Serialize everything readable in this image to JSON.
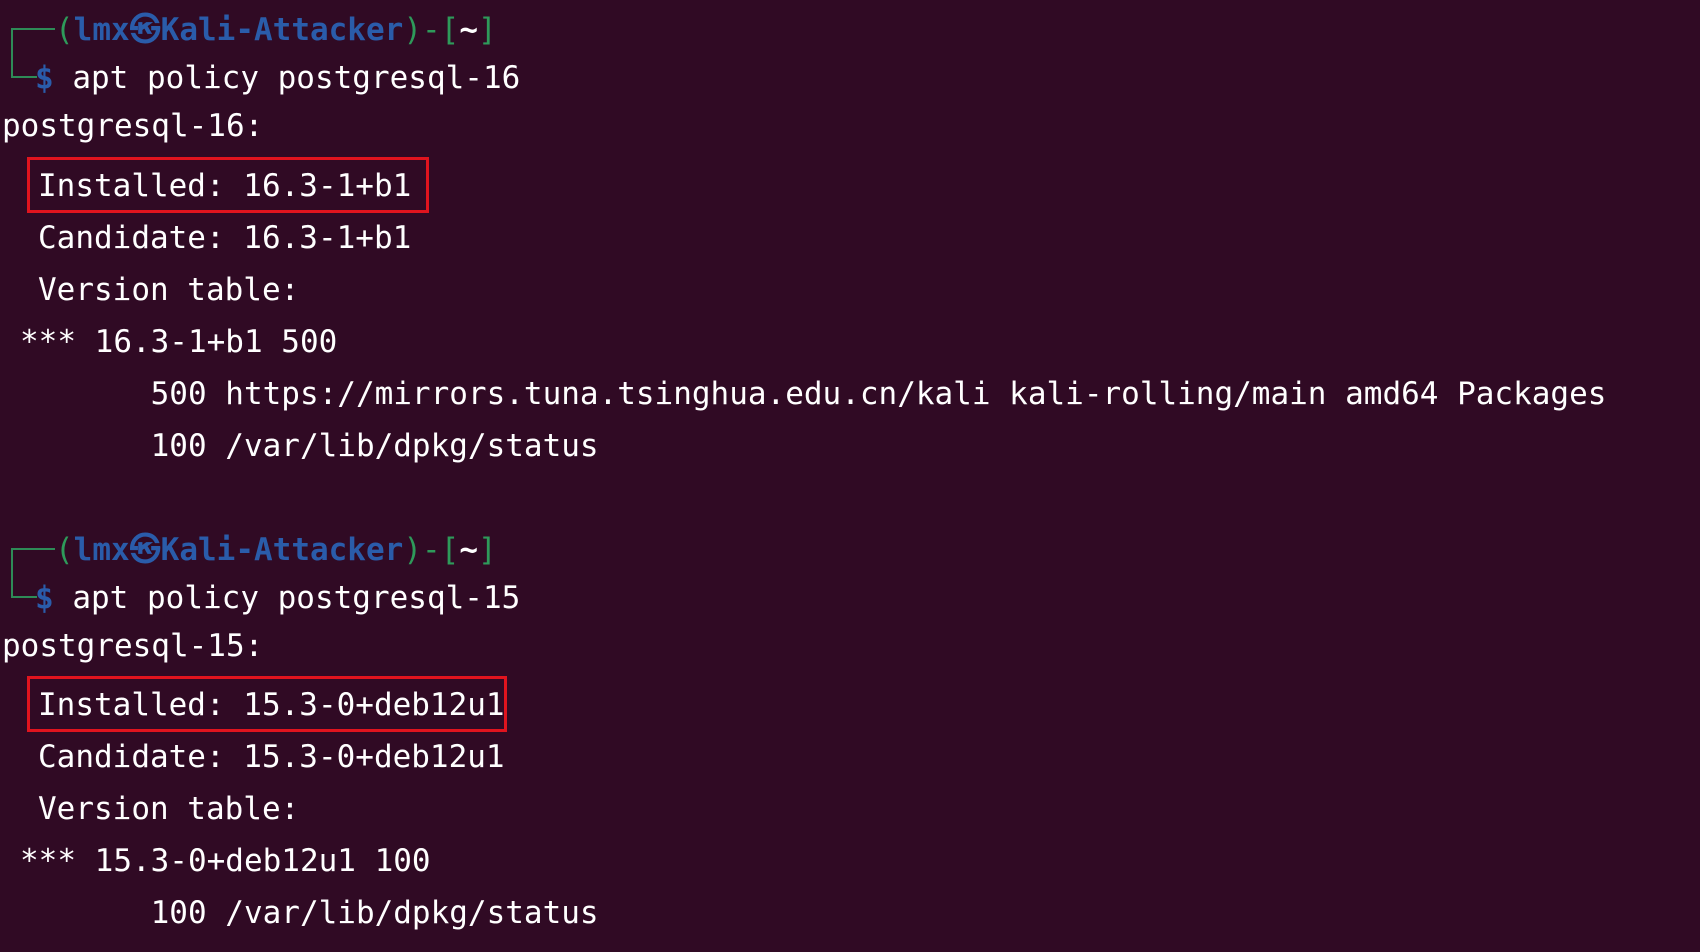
{
  "colors": {
    "background": "#300a24",
    "prompt_bracket": "#2e9a5a",
    "prompt_user": "#2a5caa",
    "text": "#ffffff",
    "highlight": "#e0141e"
  },
  "blocks": [
    {
      "prompt": {
        "open": "(",
        "user": "lmx",
        "sep": "㉿",
        "host": "Kali-Attacker",
        "close": ")-[",
        "dir": "~",
        "end": "]",
        "symbol": "$"
      },
      "command": "apt policy postgresql-16",
      "package": "postgresql-16:",
      "installed": "Installed: 16.3-1+b1",
      "candidate": "Candidate: 16.3-1+b1",
      "version_table": "Version table:",
      "entries": [
        "*** 16.3-1+b1 500",
        "       500 https://mirrors.tuna.tsinghua.edu.cn/kali kali-rolling/main amd64 Packages",
        "       100 /var/lib/dpkg/status"
      ]
    },
    {
      "prompt": {
        "open": "(",
        "user": "lmx",
        "sep": "㉿",
        "host": "Kali-Attacker",
        "close": ")-[",
        "dir": "~",
        "end": "]",
        "symbol": "$"
      },
      "command": "apt policy postgresql-15",
      "package": "postgresql-15:",
      "installed": "Installed: 15.3-0+deb12u1",
      "candidate": "Candidate: 15.3-0+deb12u1",
      "version_table": "Version table:",
      "entries": [
        "*** 15.3-0+deb12u1 100",
        "       100 /var/lib/dpkg/status"
      ]
    }
  ]
}
